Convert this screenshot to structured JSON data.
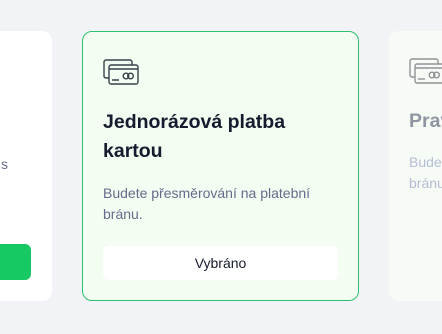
{
  "cards": [
    {
      "desc_tail": "s"
    },
    {
      "icon": "credit-card-icon",
      "title": "Jednorázová platba kartou",
      "description": "Budete přesměrování na platební bránu.",
      "button_label": "Vybráno",
      "selected": true,
      "accent_color": "#2ec06d"
    },
    {
      "icon": "credit-card-icon",
      "title": "Pravidelná platba",
      "description": "Budete přesměrování na platební bránu."
    }
  ],
  "colors": {
    "primary_button": "#16c964",
    "selected_border": "#2ec06d",
    "selected_background": "#f3fdf2"
  }
}
